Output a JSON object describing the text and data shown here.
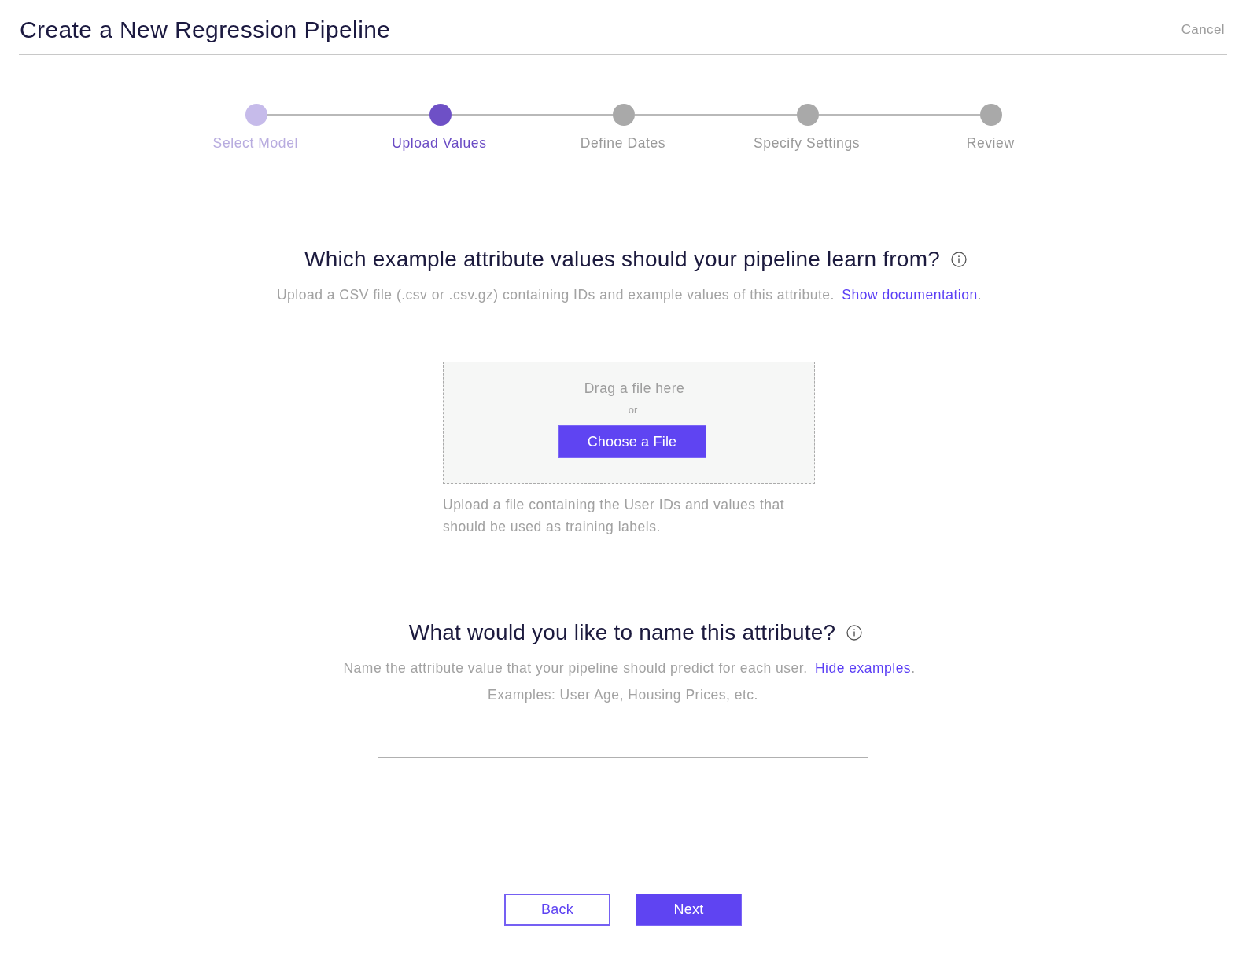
{
  "header": {
    "title": "Create a New Regression Pipeline",
    "cancel": "Cancel"
  },
  "steps": [
    {
      "label": "Select Model",
      "completed": true,
      "selected": false
    },
    {
      "label": "Upload Values",
      "completed": false,
      "selected": true
    },
    {
      "label": "Define Dates",
      "completed": false,
      "selected": false
    },
    {
      "label": "Specify Settings",
      "completed": false,
      "selected": false
    },
    {
      "label": "Review",
      "completed": false,
      "selected": false
    }
  ],
  "upload_section": {
    "heading": "Which example attribute values should your pipeline learn from?",
    "description": "Upload a CSV file (.csv or .csv.gz) containing IDs and example values of this attribute.",
    "link": "Show documentation",
    "link_suffix": ".",
    "dropzone": {
      "prompt": "Drag a file here",
      "separator": "or",
      "button": "Choose a File"
    },
    "help": "Upload a file containing the User IDs and values that should be used as training labels."
  },
  "name_section": {
    "heading": "What would you like to name this attribute?",
    "description": "Name the attribute value that your pipeline should predict for each user.",
    "link": "Hide examples",
    "link_suffix": ".",
    "examples": "Examples: User Age, Housing Prices, etc."
  },
  "footer": {
    "buttons": [
      {
        "label": "Back",
        "kind": "secondary"
      },
      {
        "label": "Next",
        "kind": "primary"
      }
    ]
  }
}
